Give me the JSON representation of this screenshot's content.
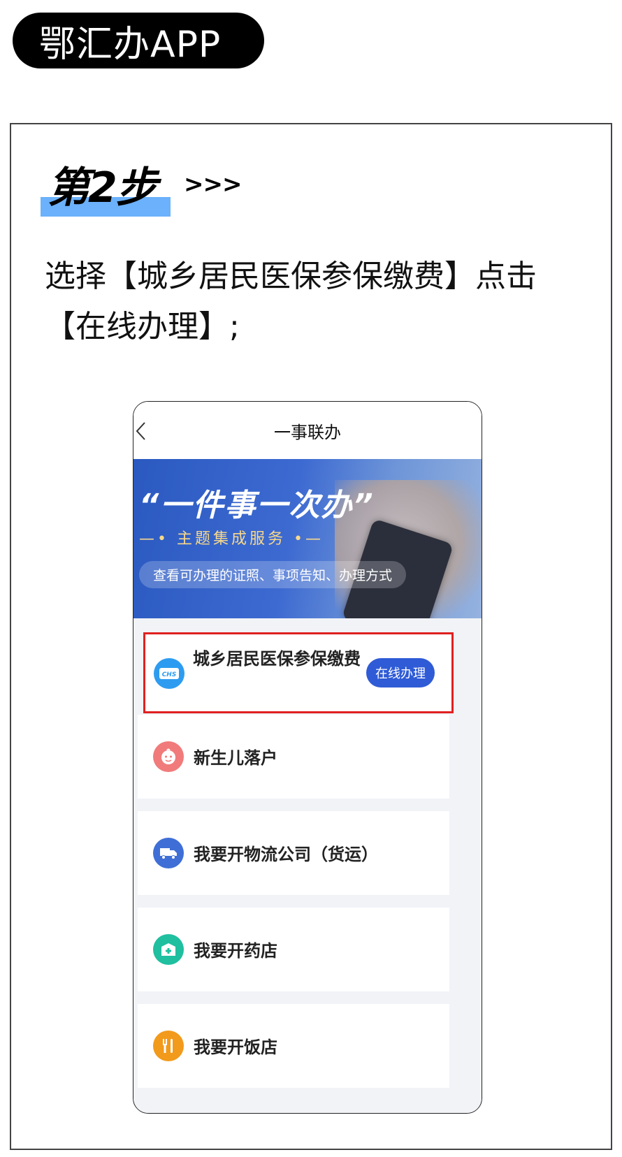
{
  "app_badge": "鄂汇办APP",
  "step": {
    "label": "第2步",
    "arrows": ">>>"
  },
  "instruction": "选择【城乡居民医保参保缴费】点击【在线办理】;",
  "phone": {
    "title": "一事联办",
    "banner": {
      "quote": "“一件事一次办”",
      "subtitle": "—• 主题集成服务 •—",
      "pill": "查看可办理的证照、事项告知、办理方式"
    },
    "highlighted_item": {
      "label": "城乡居民医保参保缴费",
      "icon": "chs-icon",
      "button": "在线办理"
    },
    "items": [
      {
        "label": "新生儿落户",
        "icon": "baby-icon",
        "color": "#f17b7b"
      },
      {
        "label": "我要开物流公司（货运）",
        "icon": "truck-icon",
        "color": "#3f6fd6"
      },
      {
        "label": "我要开药店",
        "icon": "pharmacy-icon",
        "color": "#1fbfa0"
      },
      {
        "label": "我要开饭店",
        "icon": "restaurant-icon",
        "color": "#f29a1b"
      }
    ]
  },
  "colors": {
    "highlight_border": "#e02020",
    "button": "#2f5bd6",
    "step_underline": "#6bb1fb"
  }
}
